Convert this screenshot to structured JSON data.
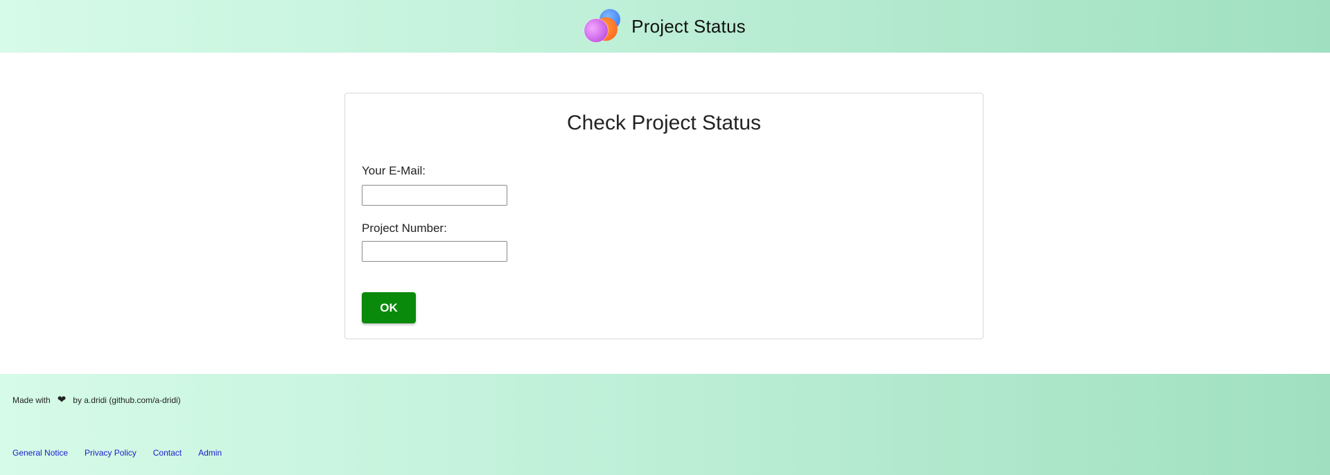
{
  "header": {
    "logo_icon": "overlapping-circles-logo-icon",
    "title": "Project Status",
    "colors": {
      "gradient_start": "#d6fbe8",
      "gradient_end": "#a0e0c0"
    }
  },
  "form": {
    "title": "Check Project Status",
    "email_label": "Your E-Mail:",
    "email_value": "",
    "email_placeholder": "",
    "project_label": "Project Number:",
    "project_value": "",
    "project_placeholder": "",
    "submit_label": "OK",
    "submit_color": "#0a8a0a"
  },
  "footer": {
    "made_with": "Made with",
    "heart_icon": "heart-icon",
    "author": "by a.dridi (github.com/a-dridi)",
    "links": [
      {
        "label": "General Notice"
      },
      {
        "label": "Privacy Policy"
      },
      {
        "label": "Contact"
      },
      {
        "label": "Admin"
      }
    ],
    "link_color": "#1a1acc"
  }
}
